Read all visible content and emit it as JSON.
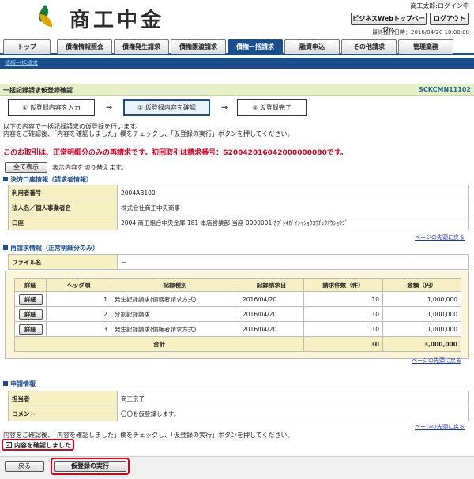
{
  "header": {
    "logo_text": "商工中金",
    "user": "商工太郎:ログイン中",
    "biz_button": "ビジネスWebトップページへ",
    "logout_button": "ログアウト",
    "last_operation": "最終操作日時：2016/04/20 10:00:00"
  },
  "tabs": [
    {
      "label": "トップ"
    },
    {
      "label": "債権情報照会"
    },
    {
      "label": "債権発生請求"
    },
    {
      "label": "債権譲渡請求"
    },
    {
      "label": "債権一括請求"
    },
    {
      "label": "融資申込"
    },
    {
      "label": "その他請求"
    },
    {
      "label": "管理業務"
    }
  ],
  "subnav": {
    "link": "債権一括請求"
  },
  "page": {
    "title": "一括記録請求仮登録確認",
    "screen_code": "SCKCMN11102"
  },
  "steps": [
    {
      "label": "① 仮登録内容を入力"
    },
    {
      "label": "② 仮登録内容を確認"
    },
    {
      "label": "③ 仮登録完了"
    }
  ],
  "step_arrow": "⇒",
  "messages": {
    "intro1": "以下の内容で一括記録請求の仮登録を行います。",
    "intro2": "内容をご確認後、「内容を確認しました」欄をチェックし、「仮登録の実行」ボタンを押してください。",
    "warning": "このお取引は、正常明細分のみの再請求です。初回取引は請求番号：S20042016042000000080です。"
  },
  "toggle": {
    "button": "全て表示",
    "desc": "表示内容を切り替えます。"
  },
  "settlement": {
    "heading": "決済口座情報（請求者情報）",
    "rows": [
      {
        "label": "利用者番号",
        "value": "2004AB100"
      },
      {
        "label": "法人名／個人事業者名",
        "value": "株式会社商工中央商事"
      },
      {
        "label": "口座",
        "value": "2004 商工組合中央金庫 181 本店営業部 当座 0000001 ｶﾌﾞｼｷｶﾞｲｼｬｼｮｳｺｳﾁｭｳｵｳｼｮｳｼﾞ"
      }
    ]
  },
  "back_to_top": "ページの先頭に戻る",
  "rerequest": {
    "heading": "再請求情報（正常明細分のみ）",
    "file_label": "ファイル名",
    "file_value": "－",
    "columns": [
      "詳細",
      "ヘッダ順",
      "記録種別",
      "記録請求日",
      "請求件数（件）",
      "金額（円）"
    ],
    "rows": [
      {
        "detail": "詳細",
        "order": "1",
        "type": "発生記録請求(債務者請求方式)",
        "date": "2016/04/20",
        "count": "10",
        "amount": "1,000,000"
      },
      {
        "detail": "詳細",
        "order": "2",
        "type": "分割記録請求",
        "date": "2016/04/20",
        "count": "10",
        "amount": "1,000,000"
      },
      {
        "detail": "詳細",
        "order": "3",
        "type": "発生記録請求(債権者請求方式)",
        "date": "2016/04/20",
        "count": "10",
        "amount": "1,000,000"
      }
    ],
    "total": {
      "label": "合計",
      "count": "30",
      "amount": "3,000,000"
    }
  },
  "application": {
    "heading": "申請情報",
    "rows": [
      {
        "label": "担当者",
        "value": "商工京子"
      },
      {
        "label": "コメント",
        "value": "〇〇を仮登録します。"
      }
    ]
  },
  "confirm": {
    "instruction": "内容をご確認後、「内容を確認しました」欄をチェックし、「仮登録の実行」ボタンを押してください。",
    "checkbox_label": "内容を確認しました",
    "checked_mark": "✓"
  },
  "buttons": {
    "back": "戻る",
    "execute": "仮登録の実行"
  },
  "colors": {
    "brand_blue": "#1b4f8c",
    "warning_red": "#d4001f",
    "highlight_red": "#e0001a",
    "label_bg": "#f7f0c2"
  }
}
